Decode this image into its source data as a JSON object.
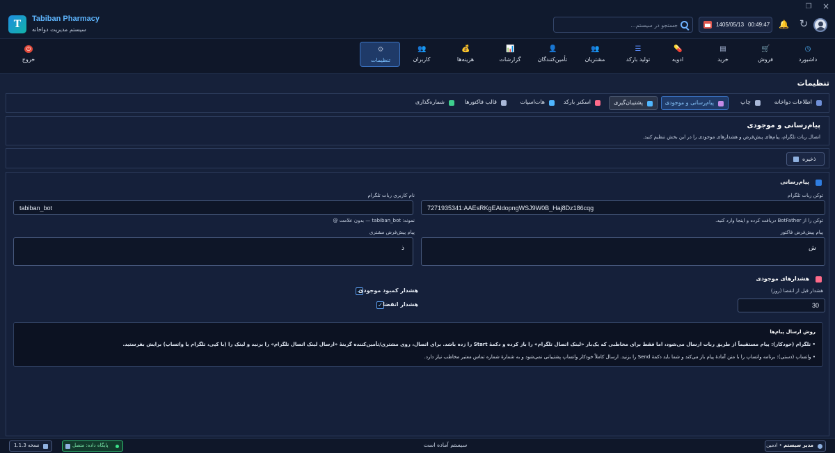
{
  "app": {
    "name": "Tabiban Pharmacy",
    "subtitle": "سیستم مدیریت دواخانه",
    "logo_letter": "T"
  },
  "header": {
    "search_placeholder": "جستجو در سیستم...",
    "date": "1405/05/13",
    "time": "00:49:47",
    "icons": [
      "search-icon",
      "calendar-icon",
      "bell-icon",
      "refresh-icon",
      "avatar"
    ]
  },
  "nav": {
    "items": [
      {
        "key": "dashboard",
        "label": "داشبورد",
        "icon": "dashboard-icon",
        "glyph": "◷",
        "color": "#4fb6ff"
      },
      {
        "key": "sales",
        "label": "فروش",
        "icon": "cart-icon",
        "glyph": "🛒",
        "color": "#3ecf8e"
      },
      {
        "key": "purchase",
        "label": "خرید",
        "icon": "document-icon",
        "glyph": "▤",
        "color": "#a9b8d8"
      },
      {
        "key": "medicines",
        "label": "ادویه",
        "icon": "pill-icon",
        "glyph": "💊",
        "color": "#ff6b8a"
      },
      {
        "key": "barcode",
        "label": "تولید بارکد",
        "icon": "barcode-icon",
        "glyph": "☰",
        "color": "#5a8dff"
      },
      {
        "key": "customers",
        "label": "مشتریان",
        "icon": "customers-icon",
        "glyph": "👥",
        "color": "#f0b94a"
      },
      {
        "key": "suppliers",
        "label": "تأمین‌کنندگان",
        "icon": "supplier-icon",
        "glyph": "👤",
        "color": "#f0b94a"
      },
      {
        "key": "reports",
        "label": "گزارشات",
        "icon": "chart-icon",
        "glyph": "📊",
        "color": "#4fb6ff"
      },
      {
        "key": "expenses",
        "label": "هزینه‌ها",
        "icon": "money-bag-icon",
        "glyph": "💰",
        "color": "#3ecf8e"
      },
      {
        "key": "users",
        "label": "کاربران",
        "icon": "users-icon",
        "glyph": "👥",
        "color": "#f0b94a"
      },
      {
        "key": "settings",
        "label": "تنظیمات",
        "icon": "gear-icon",
        "glyph": "⚙",
        "color": "#9aa9c4"
      },
      {
        "key": "exit",
        "label": "خروج",
        "icon": "power-icon",
        "glyph": "⏻",
        "color": "#ffffff"
      }
    ],
    "active": "settings"
  },
  "page": {
    "title": "تنظیمات"
  },
  "tabs": [
    {
      "label": "اطلاعات دواخانه",
      "icon": "pharmacy-info-icon",
      "color": "#6f8fd8"
    },
    {
      "label": "چاپ",
      "icon": "printer-icon",
      "color": "#a9b8d8"
    },
    {
      "label": "پیام‌رسانی و موجودی",
      "icon": "messaging-icon",
      "color": "#c58be8",
      "state": "selected"
    },
    {
      "label": "پشتیبان‌گیری",
      "icon": "backup-icon",
      "color": "#4fb6ff",
      "state": "hover"
    },
    {
      "label": "اسکنر بارکد",
      "icon": "scanner-icon",
      "color": "#ff6b8a"
    },
    {
      "label": "هات‌اسپات",
      "icon": "wifi-icon",
      "color": "#4fb6ff"
    },
    {
      "label": "قالب فاکتورها",
      "icon": "invoice-template-icon",
      "color": "#a9b8d8"
    },
    {
      "label": "شماره‌گذاری",
      "icon": "numbering-icon",
      "color": "#3ecf8e"
    }
  ],
  "section": {
    "title": "پیام‌رسانی و موجودی",
    "description": "اتصال ربات تلگرام، پیام‌های پیش‌فرض و هشدارهای موجودی را در این بخش تنظیم کنید."
  },
  "actions": {
    "save_label": "ذخیره"
  },
  "messaging": {
    "heading": "پیام‌رسانی",
    "token_label": "توکن ربات تلگرام",
    "token_value": "7271935341:AAEsRKgEAldopngWSJ9W0B_Haj8Dz186cqg",
    "token_hint": "توکن را از BotFather دریافت کرده و اینجا وارد کنید.",
    "username_label": "نام کاربری ربات تلگرام",
    "username_value": "tabiban_bot",
    "username_hint": "نمونه: tabiban_bot — بدون علامت @",
    "invoice_msg_label": "پیام پیش‌فرض فاکتور",
    "invoice_msg_value": "ش",
    "customer_msg_label": "پیام پیش‌فرض مشتری",
    "customer_msg_value": "ذ"
  },
  "stock_alerts": {
    "heading": "هشدارهای موجودی",
    "expiry_days_label": "هشدار قبل از انقضا (روز)",
    "expiry_days_value": "30",
    "low_stock_label": "هشدار کمبود موجودی",
    "low_stock_checked": true,
    "expiry_label": "هشدار انقضا",
    "expiry_checked": true
  },
  "info": {
    "title": "روش ارسال پیام‌ها",
    "line1": "• تلگرام (خودکار): پیام مستقیماً از طریق ربات ارسال می‌شود، اما فقط برای مخاطبی که یک‌بار «لینک اتصال تلگرام» را باز کرده و دکمهٔ Start را زده باشد. برای اتصال، روی مشتری/تأمین‌کننده گزینهٔ «ارسال لینک اتصال تلگرام» را بزنید و لینک را (با کپی، تلگرام یا واتساپ) برایش بفرستید.",
    "line2": "• واتساپ (دستی): برنامه واتساپ را با متن آمادهٔ پیام باز می‌کند و شما باید دکمهٔ Send را بزنید. ارسال کاملاً خودکار واتساپ پشتیبانی نمی‌شود و به شمارهٔ شماره تماس معتبر مخاطب نیاز دارد."
  },
  "statusbar": {
    "version": "نسخه 1.1.3",
    "db_status": "پایگاه داده: متصل",
    "status": "سیستم آماده است",
    "user_name": "مدیر سیستم",
    "user_role": "• ادمین"
  }
}
